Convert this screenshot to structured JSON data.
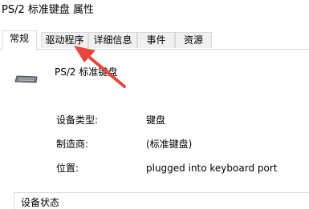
{
  "window": {
    "title": "PS/2 标准键盘 属性"
  },
  "tabs": [
    {
      "label": "常规"
    },
    {
      "label": "驱动程序"
    },
    {
      "label": "详细信息"
    },
    {
      "label": "事件"
    },
    {
      "label": "资源"
    }
  ],
  "device": {
    "name": "PS/2 标准键盘"
  },
  "properties": {
    "type_label": "设备类型:",
    "type_value": "键盘",
    "manufacturer_label": "制造商:",
    "manufacturer_value": "(标准键盘)",
    "location_label": "位置:",
    "location_value": "plugged into keyboard port"
  },
  "status_group": {
    "label": "设备状态"
  },
  "annotation": {
    "arrow_color": "#e8463f"
  }
}
